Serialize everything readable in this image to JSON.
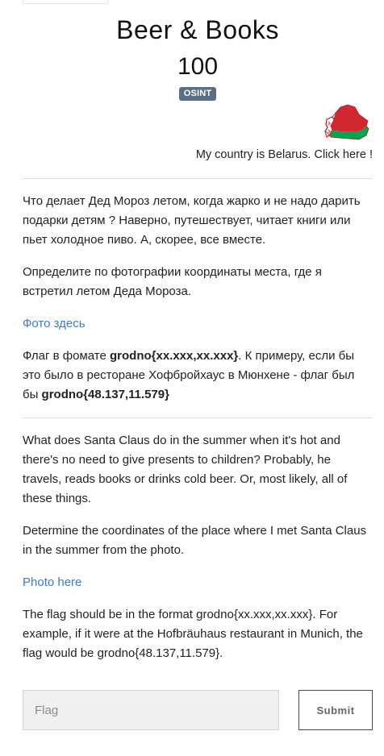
{
  "challenge": {
    "title": "Beer & Books",
    "points": "100",
    "category": "OSINT"
  },
  "country_note": {
    "link_text": "My country is Belarus. Click here !",
    "flag_icon": "belarus-map-flag-icon",
    "flag_colors": {
      "red": "#d22730",
      "green": "#00a651",
      "white": "#ffffff"
    }
  },
  "description_ru": {
    "paragraph_1": "Что делает Дед Мороз летом, когда жарко и не надо дарить подарки детям ? Наверно, путешествует, читает книги или пьет холодное пиво. А, скорее, все вместе.",
    "paragraph_2": "Определите по фотографии координаты места, где я встретил летом Деда Мороза.",
    "photo_link": "Фото здесь",
    "flag_prefix": "Флаг в фомате ",
    "flag_format": "grodno{xx.xxx,xx.xxx}",
    "flag_middle": ". К примеру, если бы это было в ресторане Хофбройхаус в Мюнхене - флаг был бы ",
    "flag_example": "grodno{48.137,11.579}"
  },
  "description_en": {
    "paragraph_1": "What does Santa Claus do in the summer when it's hot and there's no need to give presents to children? Probably, he travels, reads books or drinks cold beer. Or, most likely, all of these things.",
    "paragraph_2": "Determine the coordinates of the place where I met Santa Claus in the summer from the photo.",
    "photo_link": "Photo here",
    "paragraph_3": "The flag should be in the format grodno{xx.xxx,xx.xxx}. For example, if it were at the Hofbräuhaus restaurant in Munich, the flag would be grodno{48.137,11.579}."
  },
  "submission": {
    "placeholder": "Flag",
    "value": "",
    "submit_label": "Submit"
  },
  "colors": {
    "link": "#3a7bd5",
    "badge": "#5a6f86",
    "input_background": "#f0f0f0"
  }
}
